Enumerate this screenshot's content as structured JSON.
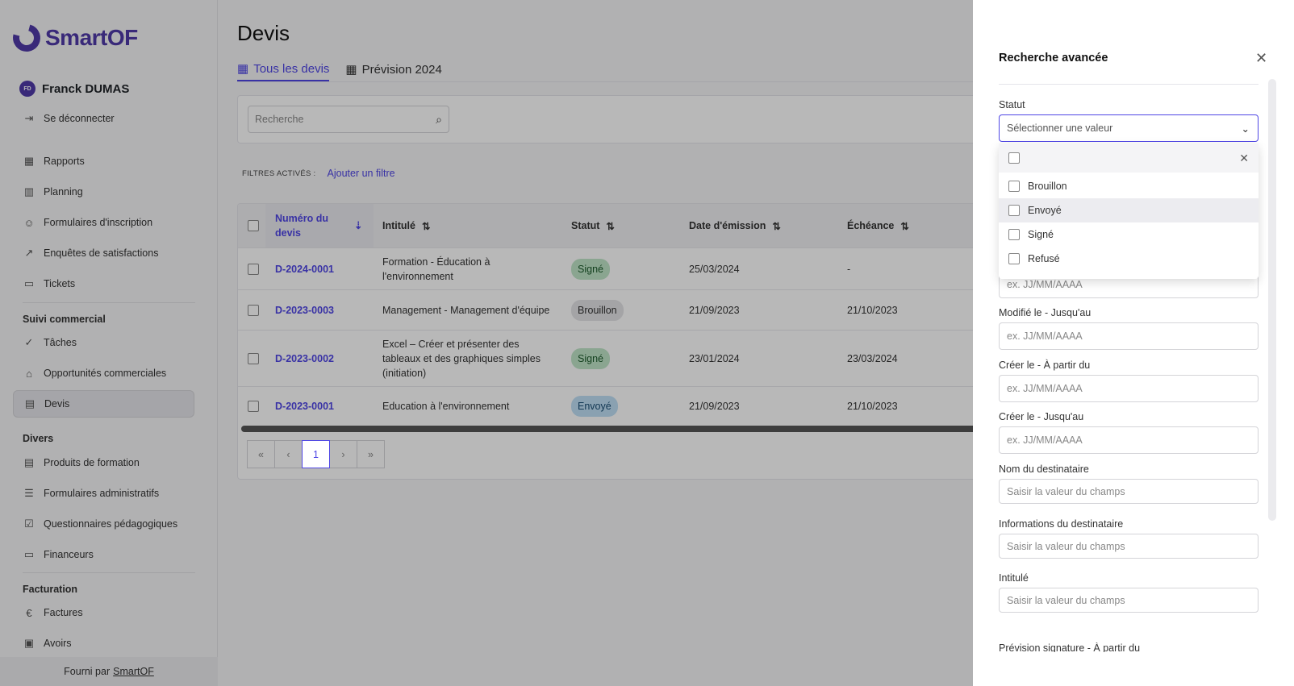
{
  "brand": {
    "name": "SmartOF",
    "color": "#4f3aa8"
  },
  "user": {
    "initials": "FD",
    "name": "Franck DUMAS",
    "logout": "Se déconnecter"
  },
  "nav": {
    "main": [
      {
        "label": "Rapports",
        "icon": "table-icon"
      },
      {
        "label": "Planning",
        "icon": "map-icon"
      },
      {
        "label": "Formulaires d'inscription",
        "icon": "user-add-icon"
      },
      {
        "label": "Enquêtes de satisfactions",
        "icon": "chart-line-icon"
      },
      {
        "label": "Tickets",
        "icon": "ticket-icon"
      }
    ],
    "sections": {
      "commercial": "Suivi commercial",
      "divers": "Divers",
      "facturation": "Facturation"
    },
    "commercial": [
      {
        "label": "Tâches"
      },
      {
        "label": "Opportunités commerciales"
      },
      {
        "label": "Devis"
      }
    ],
    "divers": [
      {
        "label": "Produits de formation"
      },
      {
        "label": "Formulaires administratifs"
      },
      {
        "label": "Questionnaires pédagogiques"
      },
      {
        "label": "Financeurs"
      }
    ],
    "facturation": [
      {
        "label": "Factures"
      },
      {
        "label": "Avoirs"
      }
    ]
  },
  "footer": {
    "prefix": "Fourni par",
    "link": "SmartOF"
  },
  "page": {
    "title": "Devis",
    "tabs": [
      "Tous les devis",
      "Prévision 2024"
    ],
    "search_placeholder": "Recherche",
    "filters_label": "FILTRES ACTIVÉS :",
    "add_filter": "Ajouter un filtre"
  },
  "table": {
    "columns": [
      "Numéro du devis",
      "Intitulé",
      "Statut",
      "Date d'émission",
      "Échéance"
    ],
    "rows": [
      {
        "num": "D-2024-0001",
        "title": "Formation - Éducation à l'environnement",
        "status": "Signé",
        "status_kind": "signe",
        "date": "25/03/2024",
        "due": "-"
      },
      {
        "num": "D-2023-0003",
        "title": "Management - Management d'équipe",
        "status": "Brouillon",
        "status_kind": "brouillon",
        "date": "21/09/2023",
        "due": "21/10/2023"
      },
      {
        "num": "D-2023-0002",
        "title": "Excel – Créer et présenter des tableaux et des graphiques simples (initiation)",
        "status": "Signé",
        "status_kind": "signe",
        "date": "23/01/2024",
        "due": "23/03/2024"
      },
      {
        "num": "D-2023-0001",
        "title": "Education à l'environnement",
        "status": "Envoyé",
        "status_kind": "envoye",
        "date": "21/09/2023",
        "due": "21/10/2023"
      }
    ],
    "pager": {
      "first": "«",
      "prev": "‹",
      "current": "1",
      "next": "›",
      "last": "»"
    }
  },
  "drawer": {
    "title": "Recherche avancée",
    "statut_label": "Statut",
    "statut_placeholder": "Sélectionner une valeur",
    "options": [
      "Brouillon",
      "Envoyé",
      "Signé",
      "Refusé"
    ],
    "fields": [
      {
        "label": "",
        "placeholder": "ex. JJ/MM/AAAA"
      },
      {
        "label": "Modifié le - Jusqu'au",
        "placeholder": "ex. JJ/MM/AAAA"
      },
      {
        "label": "Créer le - À partir du",
        "placeholder": "ex. JJ/MM/AAAA"
      },
      {
        "label": "Créer le - Jusqu'au",
        "placeholder": "ex. JJ/MM/AAAA"
      },
      {
        "label": "Nom du destinataire",
        "placeholder": "Saisir la valeur du champs"
      },
      {
        "label": "Informations du destinataire",
        "placeholder": "Saisir la valeur du champs"
      },
      {
        "label": "Intitulé",
        "placeholder": "Saisir la valeur du champs"
      }
    ],
    "cut_label": "Prévision signature - À partir du"
  }
}
